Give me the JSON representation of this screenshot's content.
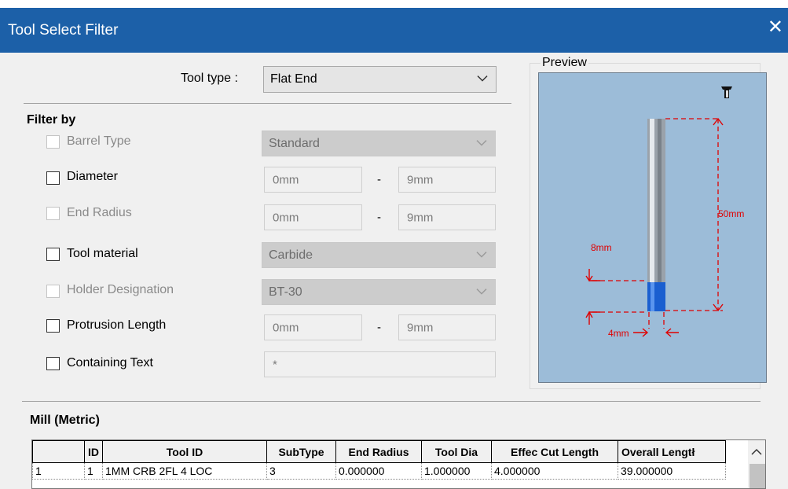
{
  "window": {
    "title": "Tool Select Filter",
    "close_glyph": "✕"
  },
  "tool_type": {
    "label": "Tool type :",
    "value": "Flat End"
  },
  "filter_by": {
    "heading": "Filter by",
    "barrel_type": {
      "label": "Barrel Type",
      "value": "Standard"
    },
    "diameter": {
      "label": "Diameter",
      "min": "0mm",
      "max": "9mm"
    },
    "end_radius": {
      "label": "End Radius",
      "min": "0mm",
      "max": "9mm"
    },
    "tool_material": {
      "label": "Tool material",
      "value": "Carbide"
    },
    "holder_designation": {
      "label": "Holder Designation",
      "value": "BT-30"
    },
    "protrusion_length": {
      "label": "Protrusion Length",
      "min": "0mm",
      "max": "9mm"
    },
    "containing_text": {
      "label": "Containing Text",
      "value": "*"
    },
    "range_separator": "-"
  },
  "preview": {
    "label": "Preview",
    "dim_overall": "50mm",
    "dim_cut": "8mm",
    "dim_dia": "4mm",
    "colors": {
      "background": "#9cbcd8",
      "dimension": "#e00000",
      "flute": "#1a5fd0"
    }
  },
  "library": {
    "title": "Mill (Metric)"
  },
  "table": {
    "columns": [
      "",
      "ID",
      "Tool ID",
      "SubType",
      "End Radius",
      "Tool Dia",
      "Effec Cut Length",
      "Overall Lengtł"
    ],
    "rows": [
      [
        "1",
        "1",
        "1MM CRB 2FL 4 LOC",
        "3",
        "0.000000",
        "1.000000",
        "4.000000",
        "39.000000"
      ]
    ]
  }
}
